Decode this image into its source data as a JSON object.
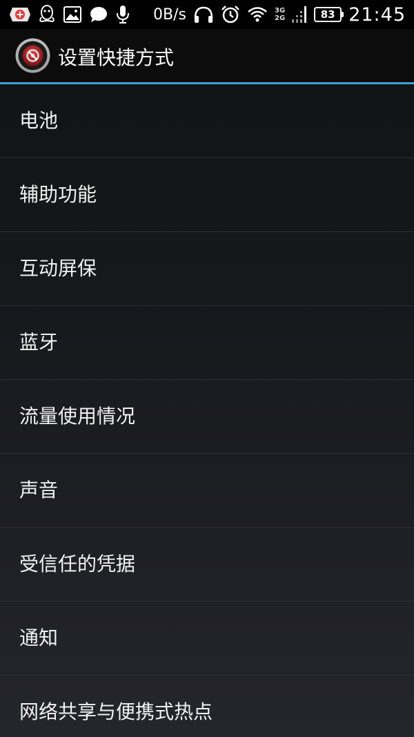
{
  "status_bar": {
    "net_speed": "0B/s",
    "network_top": "3G",
    "network_bottom": "2G",
    "battery": "83",
    "time": "21:45",
    "icons": [
      "notification-badge-icon",
      "qq-icon",
      "gallery-icon",
      "message-icon",
      "mic-icon",
      "headphones-icon",
      "alarm-icon",
      "wifi-icon",
      "signal-icon",
      "battery-icon"
    ]
  },
  "header": {
    "title": "设置快捷方式",
    "icon": "settings-app-icon"
  },
  "list": {
    "items": [
      {
        "label": "电池"
      },
      {
        "label": "辅助功能"
      },
      {
        "label": "互动屏保"
      },
      {
        "label": "蓝牙"
      },
      {
        "label": "流量使用情况"
      },
      {
        "label": "声音"
      },
      {
        "label": "受信任的凭据"
      },
      {
        "label": "通知"
      },
      {
        "label": "网络共享与便携式热点"
      }
    ]
  },
  "colors": {
    "accent": "#3aa3d8",
    "background": "#111214",
    "text": "#f2f2f2"
  }
}
